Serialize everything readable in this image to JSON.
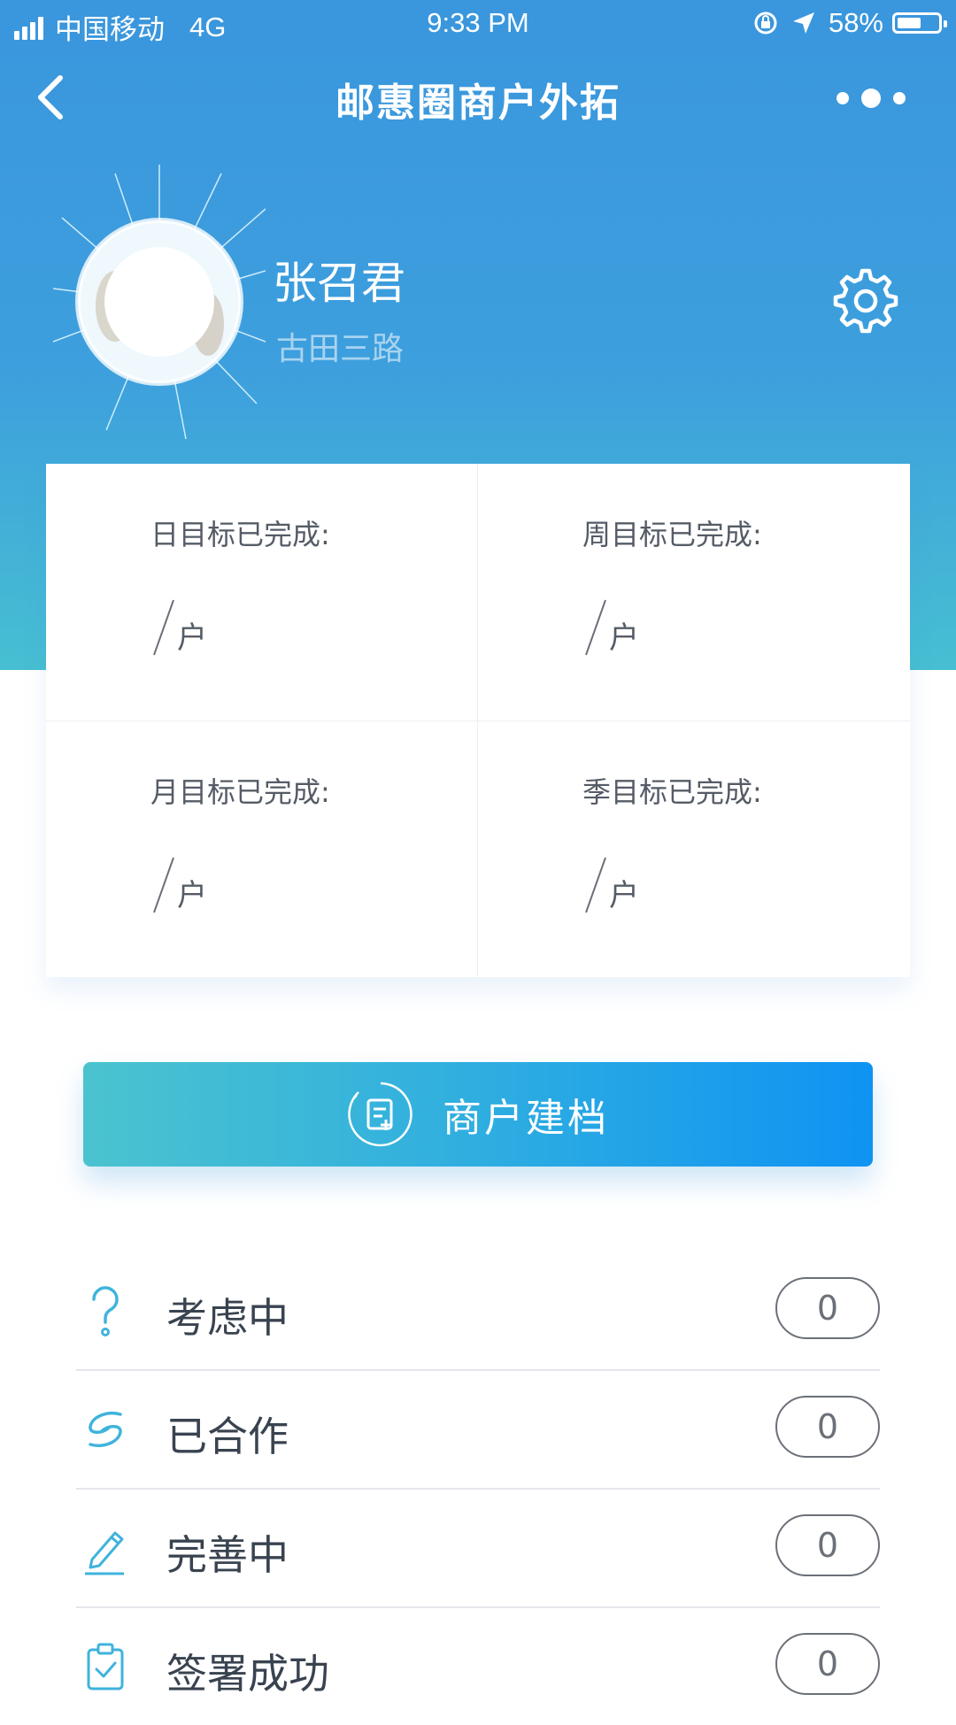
{
  "status_bar": {
    "carrier": "中国移动",
    "network": "4G",
    "time": "9:33 PM",
    "battery": "58%",
    "battery_level": 0.58
  },
  "nav": {
    "title": "邮惠圈商户外拓",
    "back_icon": "chevron-left-icon",
    "more_icon": "more-dots-icon"
  },
  "profile": {
    "name": "张召君",
    "branch": "古田三路",
    "settings_icon": "gear-icon"
  },
  "stats": [
    {
      "label": "日目标已完成:",
      "unit": "户"
    },
    {
      "label": "周目标已完成:",
      "unit": "户"
    },
    {
      "label": "月目标已完成:",
      "unit": "户"
    },
    {
      "label": "季目标已完成:",
      "unit": "户"
    }
  ],
  "create_button": {
    "label": "商户建档",
    "icon": "document-add-icon"
  },
  "status_list": [
    {
      "label": "考虑中",
      "count": "0",
      "icon": "question-icon"
    },
    {
      "label": "已合作",
      "count": "0",
      "icon": "cooperation-icon"
    },
    {
      "label": "完善中",
      "count": "0",
      "icon": "pencil-icon"
    },
    {
      "label": "签署成功",
      "count": "0",
      "icon": "clipboard-check-icon"
    }
  ],
  "colors": {
    "header_top": "#3a96dd",
    "header_bottom": "#47bfd2",
    "button_start": "#4bc3cf",
    "button_end": "#0f93f3",
    "icon_accent": "#3fb3dc"
  }
}
